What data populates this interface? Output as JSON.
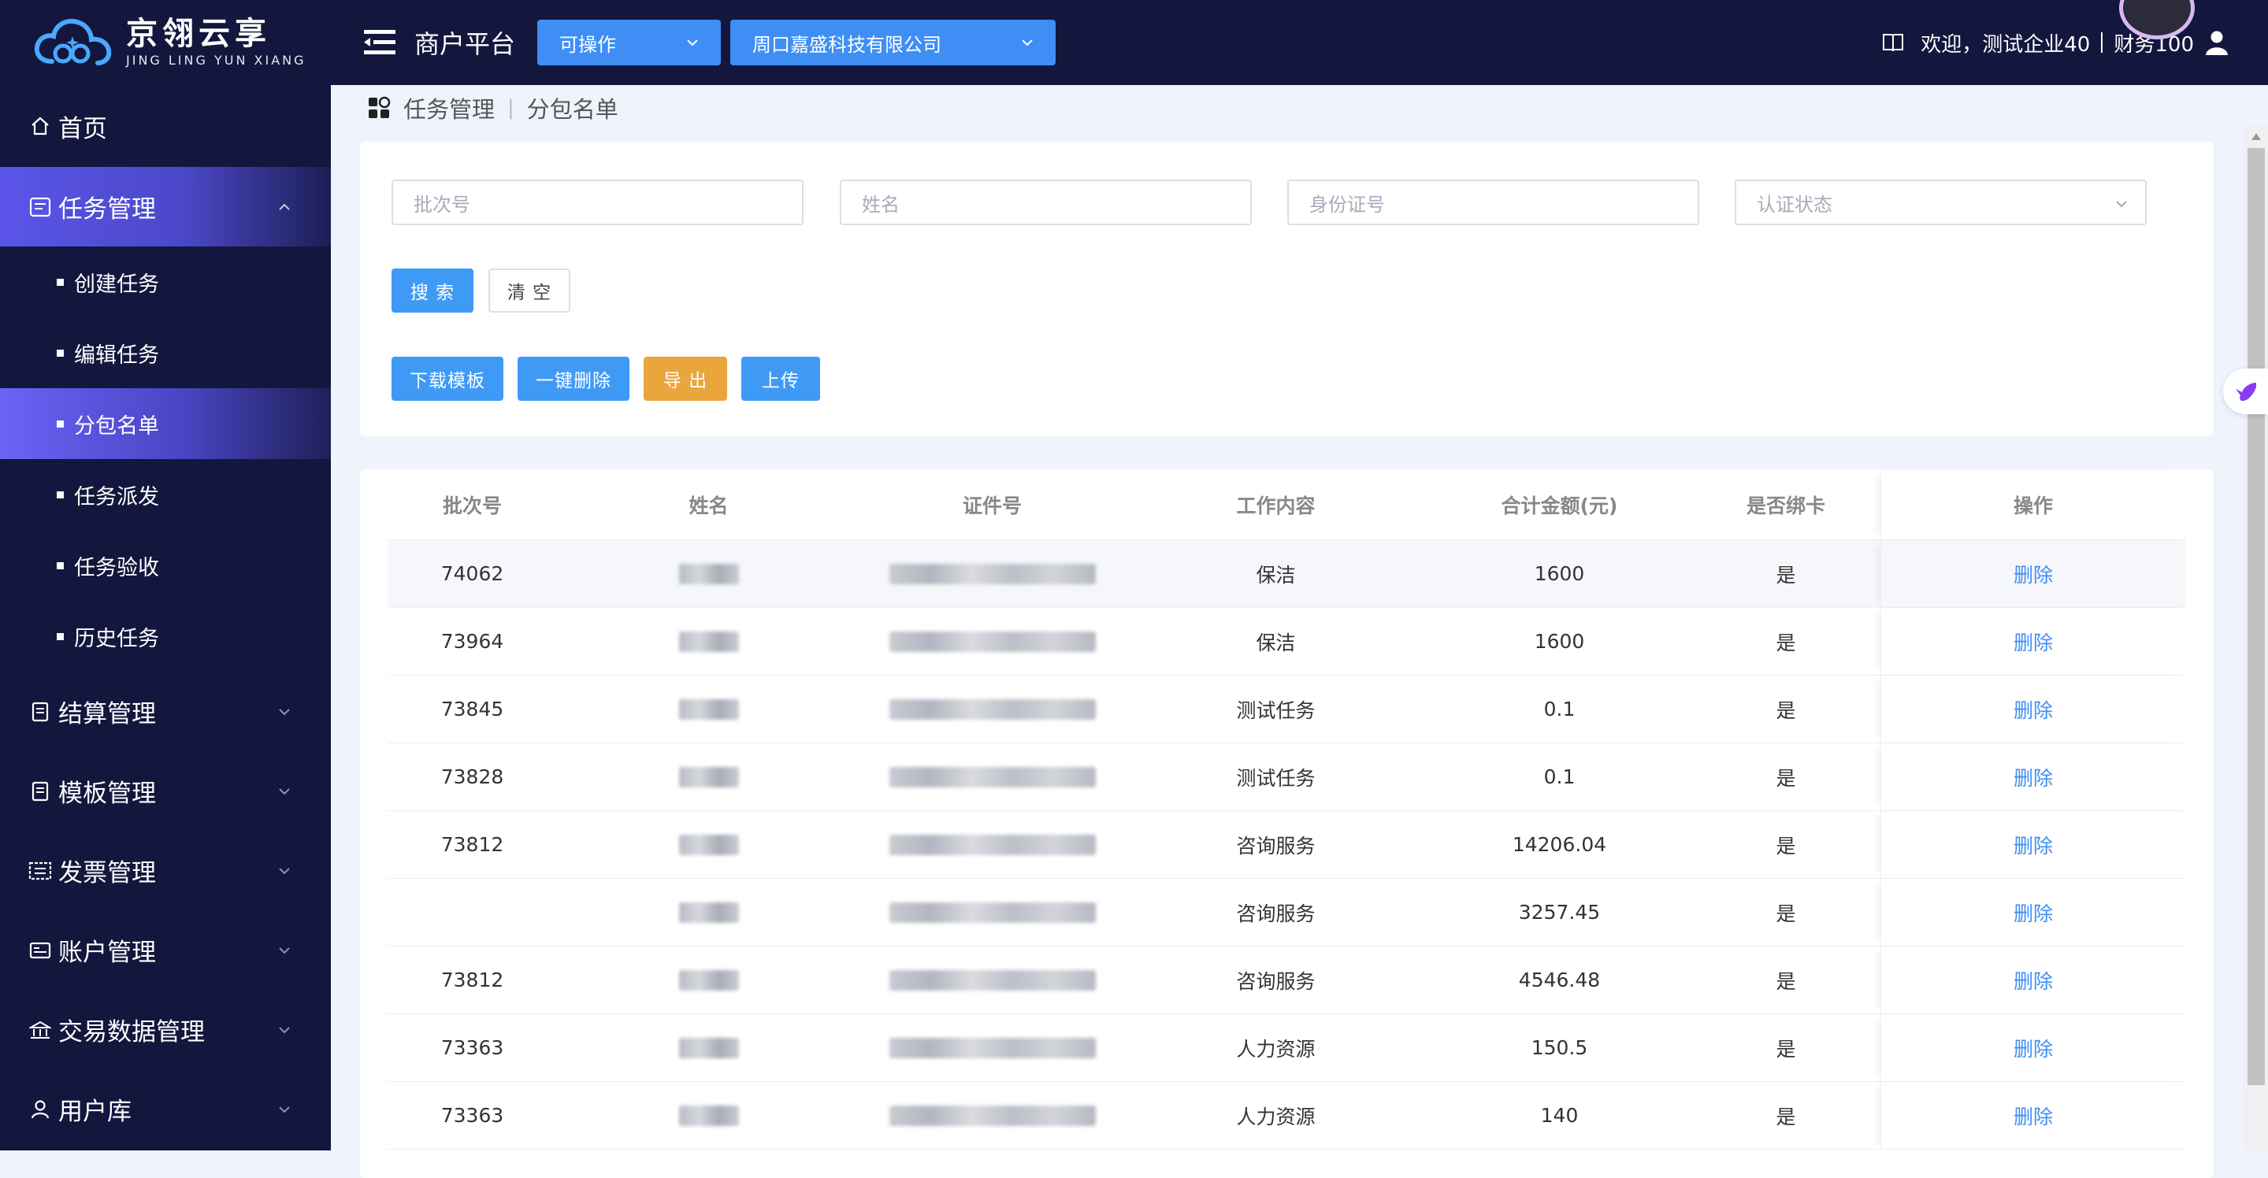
{
  "brand": {
    "name_cn": "京翎云享",
    "name_en": "JING LING YUN XIANG"
  },
  "sidebar": {
    "items": [
      {
        "label": "首页",
        "icon": "home-icon"
      },
      {
        "label": "任务管理",
        "icon": "task-icon",
        "expanded": true,
        "children": [
          {
            "label": "创建任务"
          },
          {
            "label": "编辑任务"
          },
          {
            "label": "分包名单",
            "active": true
          },
          {
            "label": "任务派发"
          },
          {
            "label": "任务验收"
          },
          {
            "label": "历史任务"
          }
        ]
      },
      {
        "label": "结算管理",
        "icon": "settlement-icon"
      },
      {
        "label": "模板管理",
        "icon": "template-icon"
      },
      {
        "label": "发票管理",
        "icon": "invoice-icon"
      },
      {
        "label": "账户管理",
        "icon": "account-icon"
      },
      {
        "label": "交易数据管理",
        "icon": "bank-icon"
      },
      {
        "label": "用户库",
        "icon": "user-icon"
      }
    ]
  },
  "header": {
    "title": "商户平台",
    "mode_select": "可操作",
    "company_select": "周口嘉盛科技有限公司",
    "welcome": "欢迎，测试企业40",
    "user": "财务100"
  },
  "breadcrumb": {
    "section": "任务管理",
    "page": "分包名单"
  },
  "filters": {
    "batch_placeholder": "批次号",
    "name_placeholder": "姓名",
    "id_placeholder": "身份证号",
    "status_placeholder": "认证状态"
  },
  "buttons": {
    "search": "搜 索",
    "clear": "清 空",
    "download_template": "下载模板",
    "delete_all": "一键删除",
    "export": "导 出",
    "upload": "上传"
  },
  "table": {
    "columns": [
      "批次号",
      "姓名",
      "证件号",
      "工作内容",
      "合计金额(元)",
      "是否绑卡",
      "操作"
    ],
    "rows": [
      {
        "batch": "74062",
        "work": "保洁",
        "amount": "1600",
        "bound": "是",
        "action": "删除"
      },
      {
        "batch": "73964",
        "work": "保洁",
        "amount": "1600",
        "bound": "是",
        "action": "删除"
      },
      {
        "batch": "73845",
        "work": "测试任务",
        "amount": "0.1",
        "bound": "是",
        "action": "删除"
      },
      {
        "batch": "73828",
        "work": "测试任务",
        "amount": "0.1",
        "bound": "是",
        "action": "删除"
      },
      {
        "batch": "73812",
        "work": "咨询服务",
        "amount": "14206.04",
        "bound": "是",
        "action": "删除"
      },
      {
        "batch": "",
        "work": "咨询服务",
        "amount": "3257.45",
        "bound": "是",
        "action": "删除"
      },
      {
        "batch": "73812",
        "work": "咨询服务",
        "amount": "4546.48",
        "bound": "是",
        "action": "删除"
      },
      {
        "batch": "73363",
        "work": "人力资源",
        "amount": "150.5",
        "bound": "是",
        "action": "删除"
      },
      {
        "batch": "73363",
        "work": "人力资源",
        "amount": "140",
        "bound": "是",
        "action": "删除"
      }
    ]
  },
  "colors": {
    "sidebar_bg": "#13173d",
    "active_menu": "#5a55e8",
    "primary": "#3f9af6",
    "warning": "#e9a63c",
    "link": "#3f8ef5"
  }
}
